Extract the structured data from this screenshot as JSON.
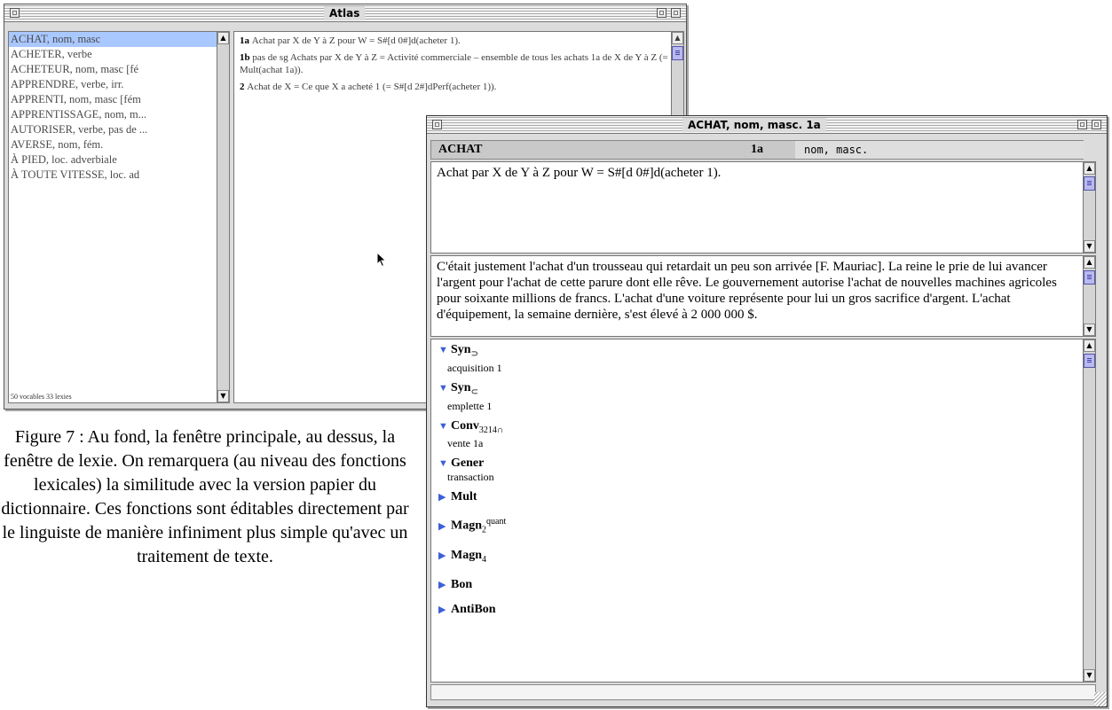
{
  "back_window": {
    "title": "Atlas",
    "entries": [
      "ACHAT, nom, masc",
      "ACHETER, verbe",
      "ACHETEUR, nom, masc [fé",
      "APPRENDRE, verbe, irr.",
      "APPRENTI, nom, masc [fém",
      "APPRENTISSAGE, nom, m...",
      "AUTORISER, verbe, pas de ...",
      "AVERSE, nom, fém.",
      "À PIED, loc. adverbiale",
      "À TOUTE VITESSE, loc. ad"
    ],
    "footer": "50 vocables    33 lexies",
    "definitions": [
      {
        "num": "1a",
        "text": "Achat par X de Y à Z pour W = S#[d 0#]d(acheter 1)."
      },
      {
        "num": "1b",
        "text": "pas de sg  Achats par X de Y à Z = Activité commerciale – ensemble de tous les achats 1a de X de Y à Z (= Mult(achat 1a))."
      },
      {
        "num": "2",
        "text": "Achat de X = Ce que X a acheté 1 (= S#[d 2#]dPerf(acheter 1))."
      }
    ]
  },
  "front_window": {
    "title": "ACHAT, nom, masc. 1a",
    "header": {
      "word": "ACHAT",
      "number": "1a",
      "pos": "nom, masc."
    },
    "definition": "Achat par X de Y à Z pour W = S#[d 0#]d(acheter 1).",
    "examples": "C'était justement l'achat d'un trousseau qui retardait un peu son arrivée [F. Mauriac].  La reine le prie de lui avancer l'argent pour l'achat de cette parure dont elle rêve.  Le gouvernement autorise l'achat de nouvelles machines agricoles pour soixante millions de francs.  L'achat d'une voiture représente pour lui un gros sacrifice d'argent.  L'achat d'équipement, la semaine dernière, s'est élevé à 2 000 000 $.",
    "functions": [
      {
        "name": "Syn",
        "sub": "⊃",
        "sup": "",
        "value": "acquisition 1",
        "expanded": true
      },
      {
        "name": "Syn",
        "sub": "⊂",
        "sup": "",
        "value": "emplette 1",
        "expanded": true
      },
      {
        "name": "Conv",
        "sub": "3214∩",
        "sup": "",
        "value": "vente 1a",
        "expanded": true
      },
      {
        "name": "Gener",
        "sub": "",
        "sup": "",
        "value": "transaction",
        "expanded": true
      },
      {
        "name": "Mult",
        "sub": "",
        "sup": "",
        "value": "",
        "expanded": false
      },
      {
        "name": "Magn",
        "sub": "2",
        "sup": "quant",
        "value": "",
        "expanded": false
      },
      {
        "name": "Magn",
        "sub": "4",
        "sup": "",
        "value": "",
        "expanded": false
      },
      {
        "name": "Bon",
        "sub": "",
        "sup": "",
        "value": "",
        "expanded": false
      },
      {
        "name": "AntiBon",
        "sub": "",
        "sup": "",
        "value": "",
        "expanded": false
      }
    ]
  },
  "caption": "Figure 7 : Au fond, la fenêtre principale, au dessus, la fenêtre de lexie. On remarquera (au niveau des fonctions lexicales) la similitude avec la version papier du dictionnaire. Ces fonctions sont éditables directement par le linguiste de manière infiniment plus simple qu'avec un traitement de texte.",
  "icons": {
    "expanded": "triangle-down-icon",
    "collapsed": "triangle-right-icon"
  },
  "colors": {
    "selection": "#a9c8ff",
    "thumb": "#b9b9ef",
    "triangle": "#3d5fd8"
  }
}
